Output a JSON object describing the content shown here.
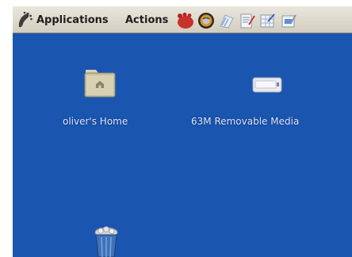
{
  "panel": {
    "menus": {
      "applications": "Applications",
      "actions": "Actions"
    },
    "launchers": [
      {
        "icon": "foot-logo-icon"
      },
      {
        "icon": "web-browser-icon"
      },
      {
        "icon": "evolution-mail-icon"
      },
      {
        "icon": "document-editor-icon"
      },
      {
        "icon": "spreadsheet-icon"
      },
      {
        "icon": "presentation-icon"
      }
    ]
  },
  "desktop": {
    "icons": [
      {
        "label": "oliver's Home",
        "icon": "home-folder-icon"
      },
      {
        "label": "63M Removable Media",
        "icon": "removable-drive-icon"
      },
      {
        "label": "",
        "icon": "trash-icon"
      }
    ]
  },
  "colors": {
    "desktop_background": "#1a56b0",
    "panel_background": "#dedacd"
  }
}
